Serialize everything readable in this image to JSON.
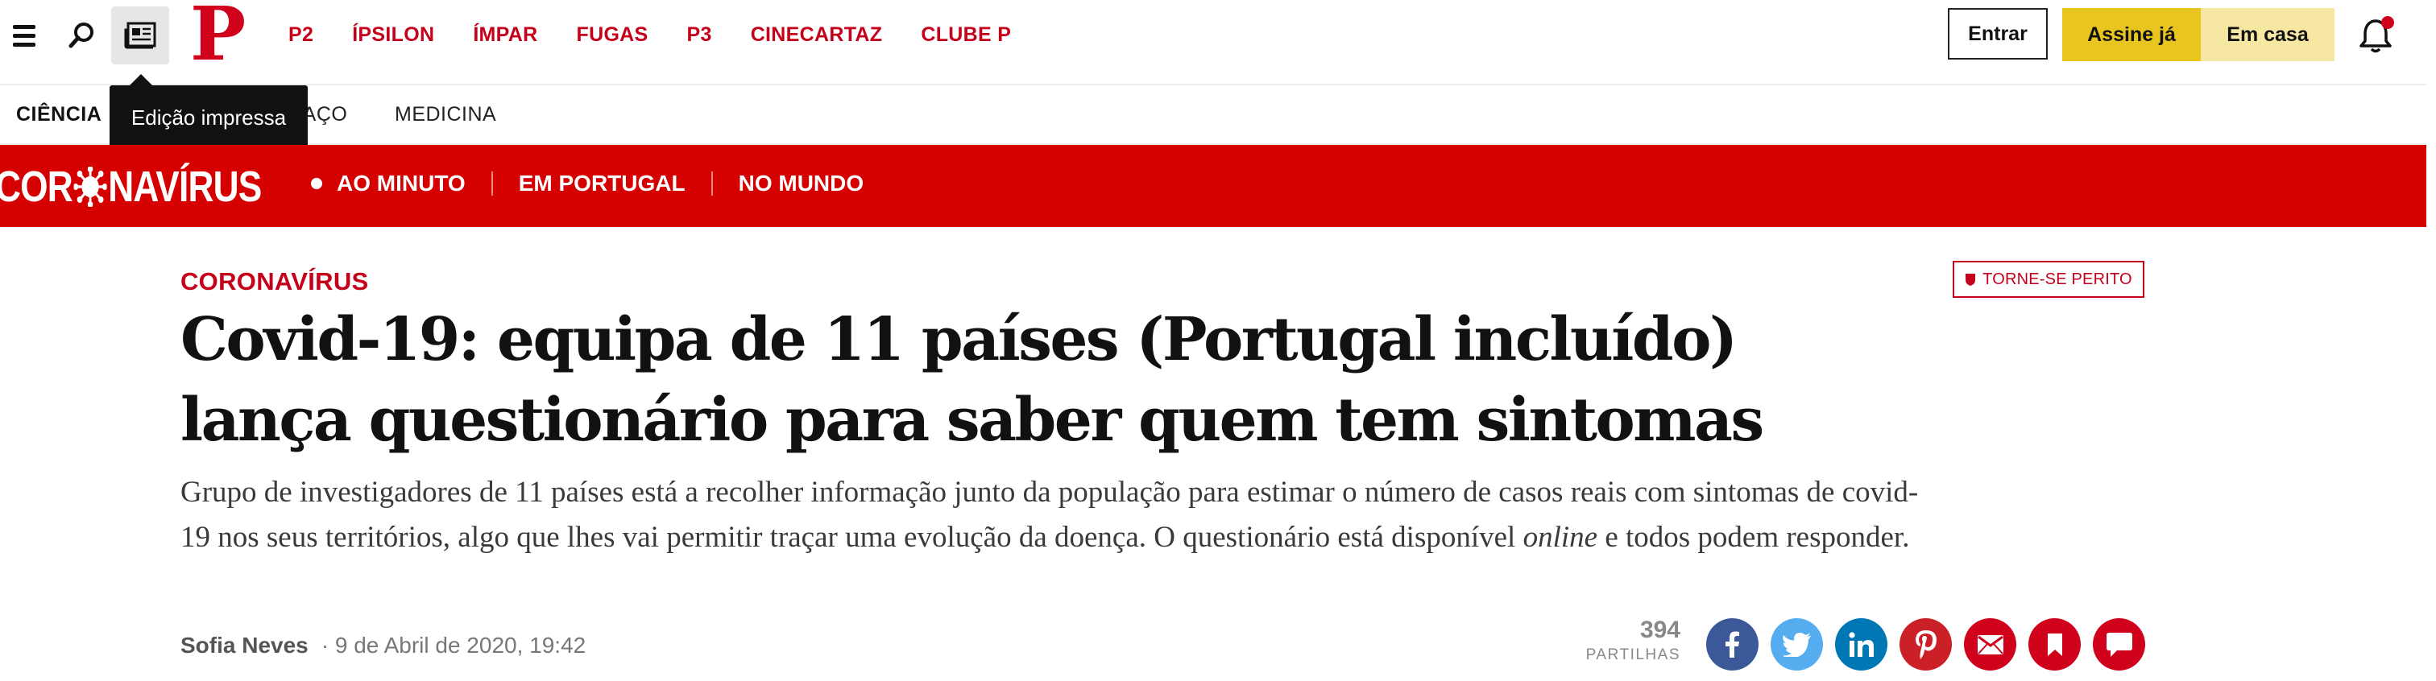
{
  "header": {
    "logo_text": "P",
    "nav": [
      "P2",
      "ÍPSILON",
      "ÍMPAR",
      "FUGAS",
      "P3",
      "CINECARTAZ",
      "CLUBE P"
    ],
    "entrar_label": "Entrar",
    "assine_label": "Assine já",
    "emcasa_label": "Em casa"
  },
  "tooltip": {
    "text": "Edição impressa"
  },
  "subnav": {
    "current": "CIÊNCIA",
    "items": [
      "ESPAÇO",
      "MEDICINA"
    ]
  },
  "covid_bar": {
    "logo_left": "COR",
    "logo_right": "NAVÍRUS",
    "links": [
      "AO MINUTO",
      "EM PORTUGAL",
      "NO MUNDO"
    ]
  },
  "article": {
    "section": "CORONAVÍRUS",
    "expert_label": "TORNE-SE PERITO",
    "headline": "Covid-19: equipa de 11 países (Portugal incluído) lança questionário para saber quem tem sintomas",
    "lead_main": "Grupo de investigadores de 11 países está a recolher informação junto da população para estimar o número de casos reais com sintomas de covid-19 nos seus territórios, algo que lhes vai permitir traçar uma evolução da doença. O questionário está disponível",
    "lead_em": "online",
    "lead_tail": " e todos podem responder.",
    "author": "Sofia Neves",
    "date": "· 9 de Abril de 2020, 19:42",
    "shares_count": "394",
    "shares_label": "PARTILHAS"
  },
  "colors": {
    "brand_red": "#c5001a",
    "covid_red": "#d50000",
    "assine_yellow": "#e8c51f",
    "emcasa_yellow": "#f6e7a3",
    "facebook": "#3b5998",
    "twitter": "#55acee",
    "linkedin": "#0077b5",
    "pinterest": "#cb2027",
    "email": "#d0021b",
    "bookmark": "#d0021b",
    "comment": "#d0021b"
  },
  "social_icons": [
    "facebook-icon",
    "twitter-icon",
    "linkedin-icon",
    "pinterest-icon",
    "email-icon",
    "bookmark-icon",
    "comment-icon"
  ]
}
